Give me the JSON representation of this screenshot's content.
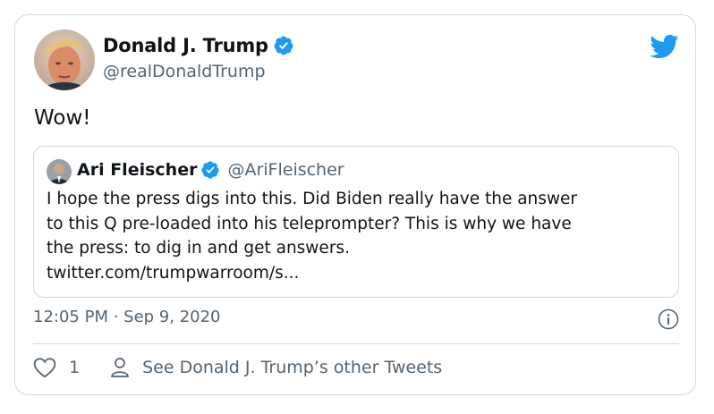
{
  "tweet": {
    "author_name": "Donald J. Trump",
    "author_handle": "@realDonaldTrump",
    "text": "Wow!",
    "timestamp": "12:05 PM · Sep 9, 2020",
    "like_count": "1",
    "see_more_label": "See Donald J. Trump’s other Tweets"
  },
  "quote": {
    "author_name": "Ari Fleischer",
    "author_handle": "@AriFleischer",
    "lines": [
      "I hope the press digs into this.  Did Biden really have the answer",
      "to this Q pre-loaded into his teleprompter?  This is why we have",
      "the press: to dig in and get answers.",
      "twitter.com/trumpwarroom/s..."
    ]
  },
  "icons": {
    "bird": "twitter-bird-icon",
    "verified": "verified-badge-icon",
    "info": "info-icon",
    "heart": "heart-icon",
    "person": "person-icon"
  },
  "colors": {
    "brand_blue": "#1d9bf0",
    "text_primary": "#0f1419",
    "text_secondary": "#536471",
    "border": "#cfd9de"
  }
}
